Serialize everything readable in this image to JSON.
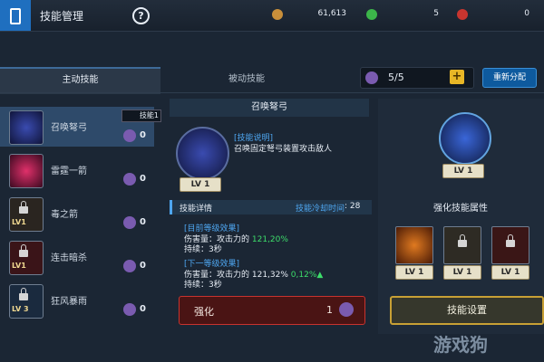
{
  "header": {
    "title": "技能管理",
    "help": "?",
    "resources": [
      {
        "value": "61,613",
        "color": "#c98f3a",
        "icon": "gold-coin-icon"
      },
      {
        "value": "5",
        "color": "#3cb54a",
        "icon": "green-gem-icon"
      },
      {
        "value": "0",
        "color": "#c8352f",
        "icon": "red-gem-icon"
      }
    ]
  },
  "tabs": {
    "active": "主动技能",
    "passive": "被动技能"
  },
  "skill_points": {
    "value": "5/5",
    "plus": "+"
  },
  "redistribute_label": "重新分配",
  "skill_badge": "技能1",
  "skills": [
    {
      "name": "召唤弩弓",
      "points": "0",
      "locked": false
    },
    {
      "name": "雷霆一箭",
      "points": "0",
      "locked": false
    },
    {
      "name": "毒之箭",
      "points": "0",
      "locked": true,
      "lv": "LV1"
    },
    {
      "name": "连击暗杀",
      "points": "0",
      "locked": true,
      "lv": "LV1"
    },
    {
      "name": "狂风暴雨",
      "points": "0",
      "locked": true,
      "lv": "LV 3"
    }
  ],
  "detail": {
    "title": "召唤弩弓",
    "level_label": "LV",
    "level": "1",
    "desc_label": "[技能说明]",
    "desc": "召唤固定弩弓装置攻击敌人",
    "details_label": "技能详情",
    "cooldown_label": "技能冷却时间",
    "cooldown": ": 28",
    "current_label": "[目前等级效果]",
    "current_damage": "伤害量：攻击力的",
    "current_damage_val": "121,20%",
    "current_duration": "持续：3秒",
    "next_label": "[下一等级效果]",
    "next_damage": "伤害量：攻击力的 121,32%",
    "next_increase": "0,12%▲",
    "next_duration": "持续：3秒"
  },
  "strengthen": {
    "label": "强化",
    "cost": "1"
  },
  "right_panel": {
    "level_label": "LV",
    "level": "1",
    "attr_title": "强化技能属性",
    "attr_levels": [
      "1",
      "1",
      "1"
    ],
    "setting_label": "技能设置"
  },
  "watermark": "游戏狗"
}
